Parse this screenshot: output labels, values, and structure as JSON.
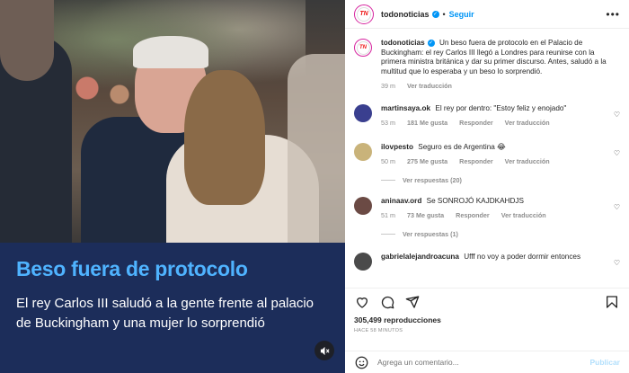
{
  "media": {
    "headline": "Beso fuera de protocolo",
    "subtitle": "El rey Carlos III saludó a la gente frente al palacio de Buckingham y una mujer lo sorprendió"
  },
  "header": {
    "username": "todonoticias",
    "verified": true,
    "separator": "•",
    "follow_label": "Seguir",
    "logo_text": "TN"
  },
  "caption": {
    "username": "todonoticias",
    "text": "Un beso fuera de protocolo en el Palacio de Buckingham: el rey Carlos III llegó a Londres para reunirse con la primera ministra británica y dar su primer discurso. Antes, saludó a la multitud que lo esperaba y un beso lo sorprendió.",
    "time": "39 m",
    "translation_label": "Ver traducción"
  },
  "comments": [
    {
      "username": "martinsaya.ok",
      "text": "El rey por dentro: \"Estoy feliz y enojado\"",
      "time": "53 m",
      "likes": "181 Me gusta",
      "reply": "Responder",
      "translate": "Ver traducción",
      "avatar_color": "#3a3f8f"
    },
    {
      "username": "ilovpesto",
      "text": "Seguro es de Argentina 😂",
      "time": "50 m",
      "likes": "275 Me gusta",
      "reply": "Responder",
      "translate": "Ver traducción",
      "replies_label": "Ver respuestas (20)",
      "avatar_color": "#c9b37a"
    },
    {
      "username": "aninaav.ord",
      "text": "Se SONROJÓ KAJDKAHDJS",
      "time": "51 m",
      "likes": "73 Me gusta",
      "reply": "Responder",
      "translate": "Ver traducción",
      "replies_label": "Ver respuestas (1)",
      "avatar_color": "#6b4a44"
    },
    {
      "username": "gabrielalejandroacuna",
      "text": "Ufff no voy a poder dormir entonces",
      "avatar_color": "#4a4a4a"
    }
  ],
  "actions": {
    "views": "305,499 reproducciones",
    "time_ago": "HACE 58 MINUTOS"
  },
  "add_comment": {
    "placeholder": "Agrega un comentario...",
    "publish": "Publicar"
  }
}
